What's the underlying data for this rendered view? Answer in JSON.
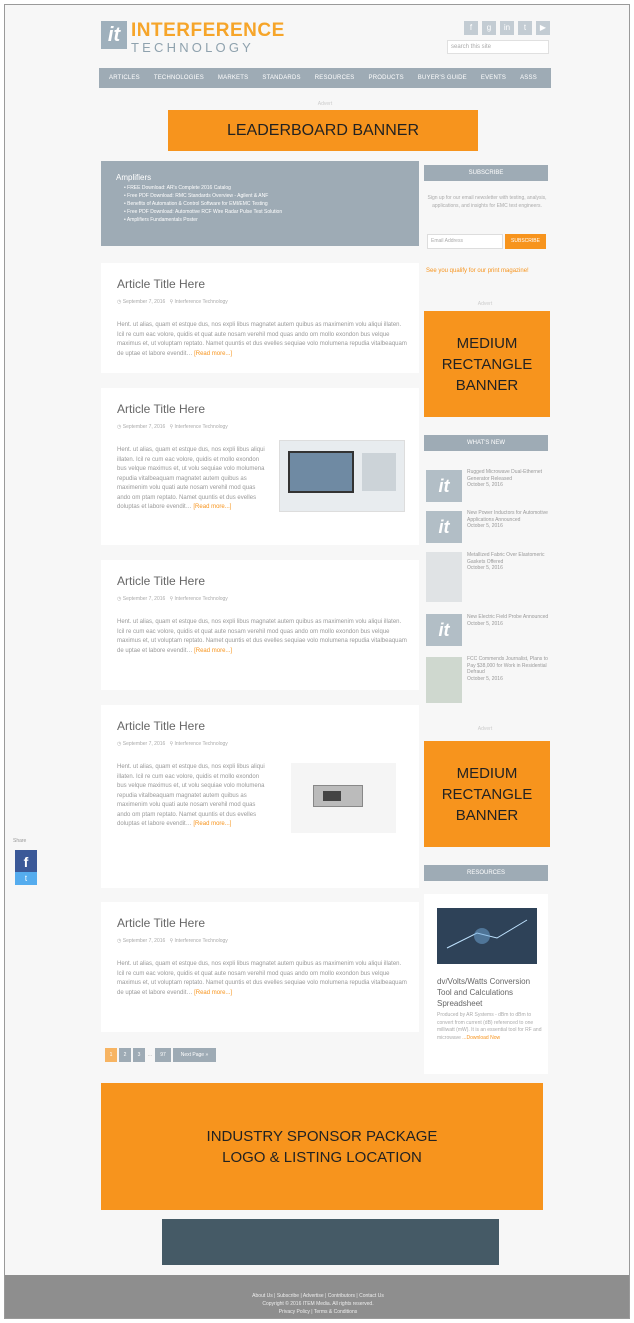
{
  "header": {
    "logo_mark": "it",
    "logo_line1": "INTERFERENCE",
    "logo_line2": "TECHNOLOGY",
    "search_placeholder": "search this site",
    "social_icons": [
      "facebook-icon",
      "google-plus-icon",
      "linkedin-icon",
      "twitter-icon",
      "youtube-icon"
    ]
  },
  "nav": [
    "ARTICLES",
    "TECHNOLOGIES",
    "MARKETS",
    "STANDARDS",
    "RESOURCES",
    "PRODUCTS",
    "BUYER'S GUIDE",
    "EVENTS",
    "ASSS"
  ],
  "ads": {
    "leaderboard": "LEADERBOARD BANNER",
    "medium1": [
      "MEDIUM",
      "RECTANGLE",
      "BANNER"
    ],
    "medium2": [
      "MEDIUM",
      "RECTANGLE",
      "BANNER"
    ],
    "sponsor": [
      "INDUSTRY SPONSOR PACKAGE",
      "LOGO & LISTING LOCATION"
    ]
  },
  "amplifiers": {
    "title": "Amplifiers",
    "items": [
      "FREE Download: AR's Complete 2016 Catalog",
      "Free PDF Download: RMC Standards Overview - Agilent & ANF",
      "Benefits of Automation & Control Software for EMI/EMC Testing",
      "Free PDF Download: Automotive RCF Wire Radar Pulse Test Solution",
      "Amplifiers Fundamentals Poster"
    ]
  },
  "articles": [
    {
      "title": "Article Title Here",
      "date": "September 7, 2016",
      "author": "Interference Technology",
      "body": "Hent. ut alias, quam et estque dus, nos expli libus magnatet autem quibus as maximenim volu aliqui illaten. Icil re cum eac volore, quidis et quat aute nosam verehil mod quas ando om mollo exondon bus velque maximus et, ut voluptam reptato. Namet quuntis et dus evelles sequiae volo molumena repudia vitalbeaquam de uptae et labore evendit…",
      "more": "[Read more...]"
    },
    {
      "title": "Article Title Here",
      "date": "September 7, 2016",
      "author": "Interference Technology",
      "body": "Hent. ut alias, quam et estque dus, nos expli libus aliqui illaten. Icil re cum eac volore, quidis et mollo exondon bus velque maximus et, ut volu sequiae volo molumena repudia vitalbeaquam magnatet autem quibus as maximenim volu quati aute nosam verehil mod quas ando om ptam reptato. Namet quuntis et dus evelles doluptas et labore evendit…",
      "more": "[Read more...]"
    },
    {
      "title": "Article Title Here",
      "date": "September 7, 2016",
      "author": "Interference Technology",
      "body": "Hent. ut alias, quam et estque dus, nos expli libus magnatet autem quibus as maximenim volu aliqui illaten. Icil re cum eac volore, quidis et quat aute nosam verehil mod quas ando om mollo exondon bus velque maximus et, ut voluptam reptato. Namet quuntis et dus evelles sequiae volo molumena repudia vitalbeaquam de uptae et labore evendit…",
      "more": "[Read more...]"
    },
    {
      "title": "Article Title Here",
      "date": "September 7, 2016",
      "author": "Interference Technology",
      "body": "Hent. ut alias, quam et estque dus, nos expli libus aliqui illaten. Icil re cum eac volore, quidis et mollo exondon bus velque maximus et, ut volu sequiae volo molumena repudia vitalbeaquam magnatet autem quibus as maximenim volu quati aute nosam verehil mod quas ando om ptam reptato. Namet quuntis et dus evelles doluptas et labore evendit…",
      "more": "[Read more...]"
    },
    {
      "title": "Article Title Here",
      "date": "September 7, 2016",
      "author": "Interference Technology",
      "body": "Hent. ut alias, quam et estque dus, nos expli libus magnatet autem quibus as maximenim volu aliqui illaten. Icil re cum eac volore, quidis et quat aute nosam verehil mod quas ando om mollo exondon bus velque maximus et, ut voluptam reptato. Namet quuntis et dus evelles sequiae volo molumena repudia vitalbeaquam de uptae et labore evendit…",
      "more": "[Read more...]"
    }
  ],
  "pagination": {
    "pages": [
      "1",
      "2",
      "3",
      "..."
    ],
    "last": "97",
    "next": "Next Page »"
  },
  "sidebar": {
    "subscribe_head": "SUBSCRIBE",
    "subscribe_text": "Sign up for our email newsletter with testing, analysis, applications, and insights for EMC test engineers.",
    "email_placeholder": "Email Address",
    "subscribe_btn": "SUBSCRIBE",
    "qualify": "See you qualify for our print magazine!",
    "advert": "Advert",
    "whats_new_head": "WHAT'S NEW",
    "whats_new": [
      {
        "title": "Rugged Microwave Dual-Ethernet Generator Released",
        "date": "October 5, 2016"
      },
      {
        "title": "New Power Inductors for Automotive Applications Announced",
        "date": "October 5, 2016"
      },
      {
        "title": "Metallized Fabric Over Elastomeric Gaskets Offered",
        "date": "October 5, 2016"
      },
      {
        "title": "New Electric Field Probe Announced",
        "date": "October 5, 2016"
      },
      {
        "title": "FCC Commends Journalist, Plans to Pay $38,000 for Work in Residential Defraud",
        "date": "October 5, 2016"
      }
    ],
    "resources_head": "RESOURCES",
    "resource_title": "dv/Volts/Watts Conversion Tool and Calculations Spreadsheet",
    "resource_desc": "Produced by AR Systems - dBm to dBm to convert from current (dB) referenced to one milliwatt (mW). It is an essential tool for RF and microwave",
    "resource_more": "...Download Now"
  },
  "share": {
    "label": "Share"
  },
  "footer": {
    "line1": "About Us | Subscribe | Advertise | Contributors | Contact Us",
    "line2": "Copyright © 2016 ITEM Media. All rights reserved.",
    "line3": "Privacy Policy | Terms & Conditions"
  },
  "colors": {
    "accent": "#f7941d",
    "slate": "#9eabb5",
    "dark": "#455a66",
    "footer": "#8e8e8e"
  }
}
